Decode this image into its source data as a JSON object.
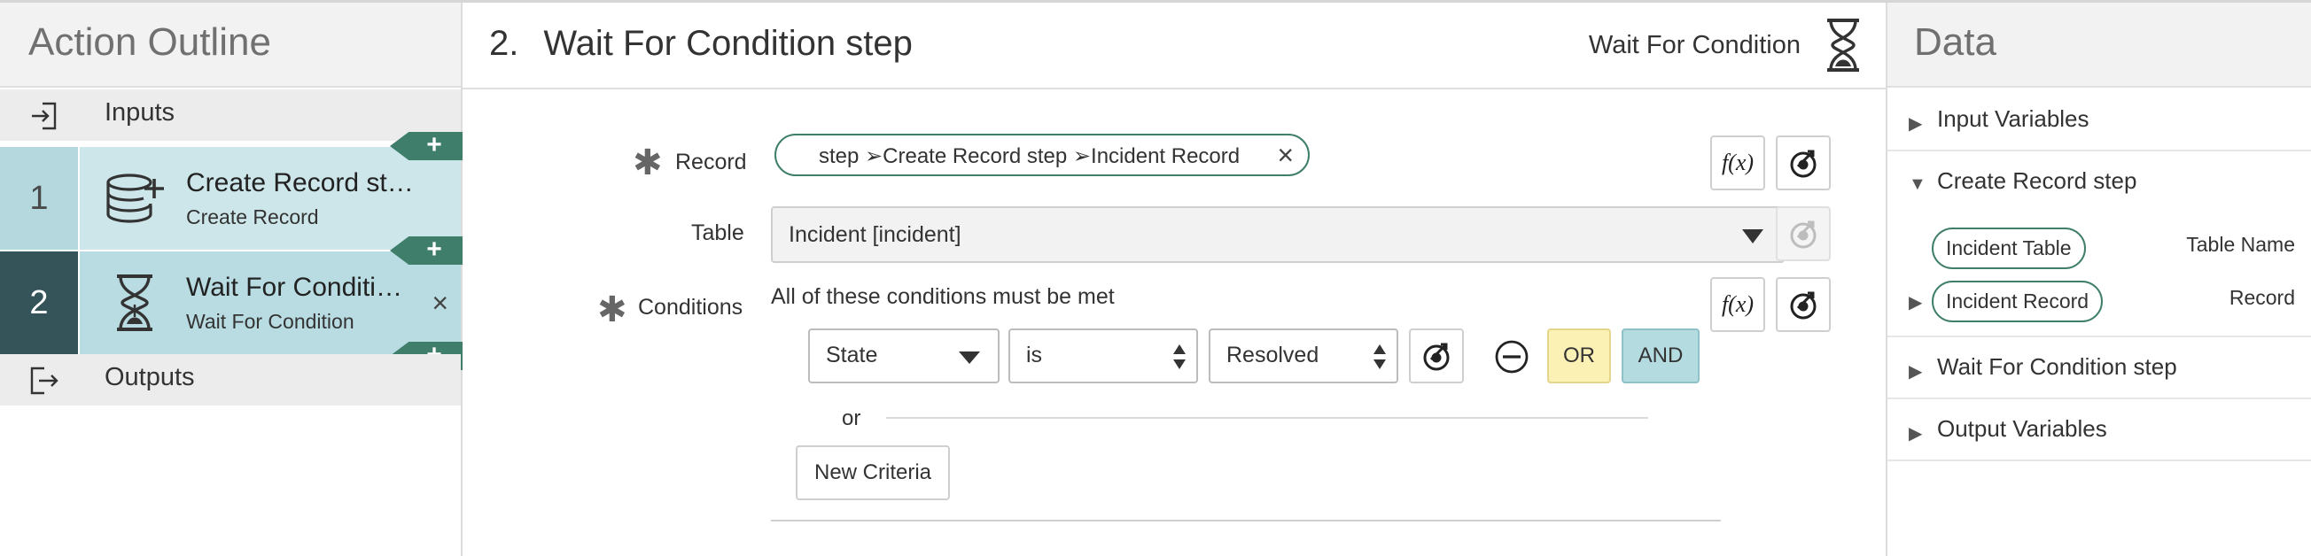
{
  "outline": {
    "title": "Action Outline",
    "inputs_label": "Inputs",
    "outputs_label": "Outputs",
    "add_symbol": "+",
    "steps": [
      {
        "number": "1",
        "title": "Create Record step",
        "subtitle": "Create Record",
        "icon": "database-add-icon",
        "selected": false
      },
      {
        "number": "2",
        "title": "Wait For Conditio…",
        "subtitle": "Wait For Condition",
        "icon": "hourglass-icon",
        "selected": true,
        "close": "×"
      }
    ]
  },
  "step": {
    "number": "2.",
    "title": "Wait For Condition step",
    "type_label": "Wait For Condition",
    "record": {
      "label": "Record",
      "required": true,
      "pill_text": "step ➢Create Record step ➢Incident Record",
      "clear": "×"
    },
    "table": {
      "label": "Table",
      "value": "Incident [incident]"
    },
    "conditions": {
      "label": "Conditions",
      "required": true,
      "description": "All of these conditions must be met",
      "field": "State",
      "operator": "is",
      "value": "Resolved",
      "or_button": "OR",
      "and_button": "AND",
      "or_separator": "or",
      "new_criteria": "New Criteria"
    },
    "fx_label": "f(x)"
  },
  "data_panel": {
    "title": "Data",
    "sections": [
      {
        "label": "Input Variables",
        "expanded": false
      },
      {
        "label": "Create Record step",
        "expanded": true
      },
      {
        "label": "Wait For Condition step",
        "expanded": false
      },
      {
        "label": "Output Variables",
        "expanded": false
      }
    ],
    "create_record_children": [
      {
        "pill": "Incident Table",
        "label": "Table Name",
        "expandable": false
      },
      {
        "pill": "Incident Record",
        "label": "Record",
        "expandable": true
      }
    ]
  },
  "colors": {
    "accent": "#3f7e6a",
    "step_number_bg": "#b4d8dd",
    "step_body_bg": "#cde6ea",
    "selected_number_bg": "#34545a",
    "selected_body_bg": "#b8dce2",
    "or_bg": "#fbf1b5",
    "and_bg": "#b4dbe0"
  }
}
